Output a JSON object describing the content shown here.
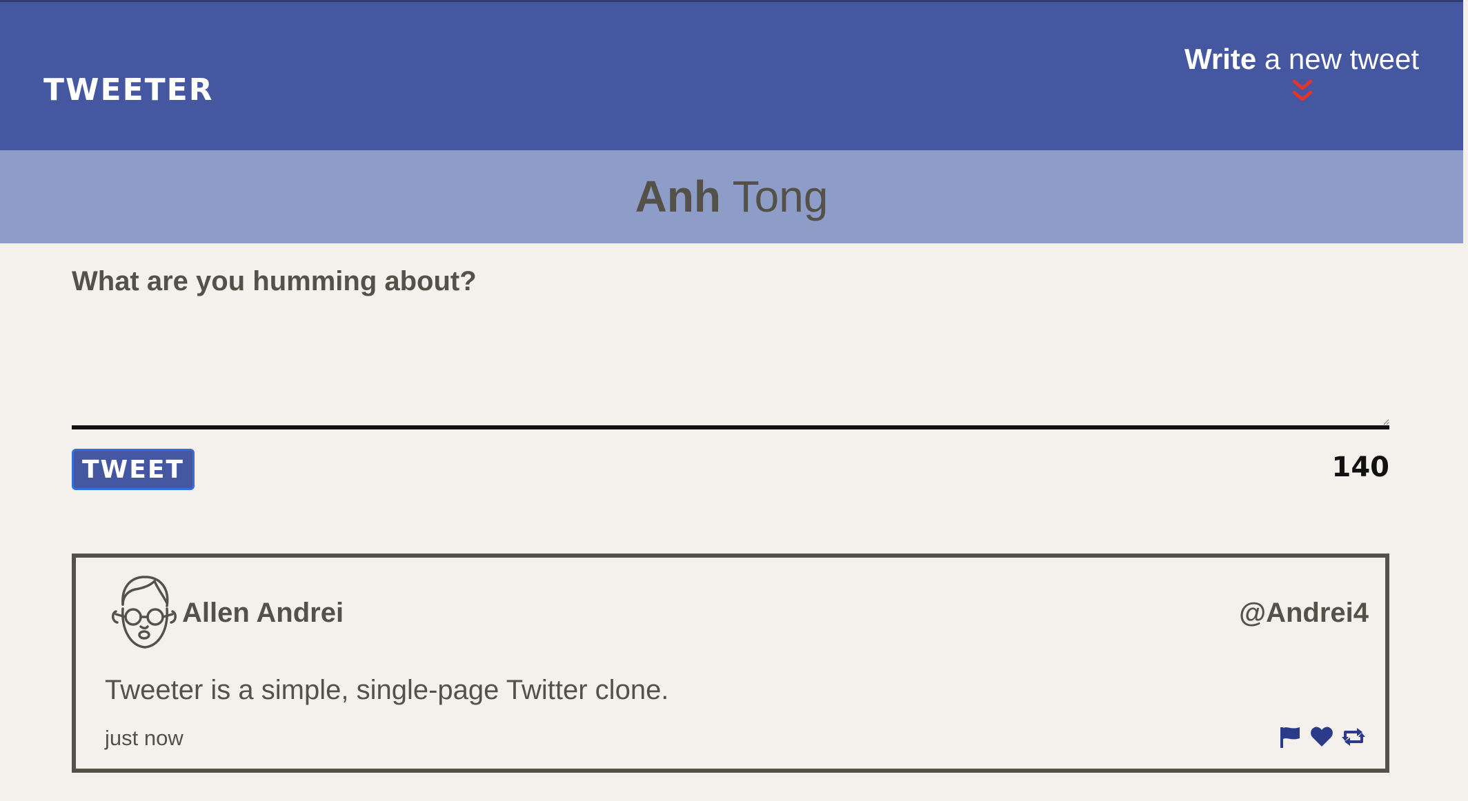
{
  "navbar": {
    "logo": "TWEETER",
    "compose_bold": "Write",
    "compose_rest": "a new tweet",
    "compose_toggle_icon": "double-chevron-down-icon"
  },
  "profile": {
    "first_name": "Anh",
    "last_name": "Tong"
  },
  "composer": {
    "label": "What are you humming about?",
    "input_value": "",
    "button_label": "TWEET",
    "char_counter": "140"
  },
  "tweets": [
    {
      "author_name": "Allen Andrei",
      "handle": "@Andrei4",
      "text": "Tweeter is a simple, single-page Twitter clone.",
      "timestamp": "just now",
      "avatar_icon": "avatar-glasses-icon",
      "action_icons": [
        "flag-icon",
        "heart-icon",
        "retweet-icon"
      ]
    }
  ],
  "colors": {
    "nav_bg": "#4457a0",
    "profile_bg": "#8e9dc7",
    "page_bg": "#f4f1ec",
    "text": "#545149",
    "accent_red": "#e0352b",
    "icon_navy": "#2b3a8a"
  }
}
